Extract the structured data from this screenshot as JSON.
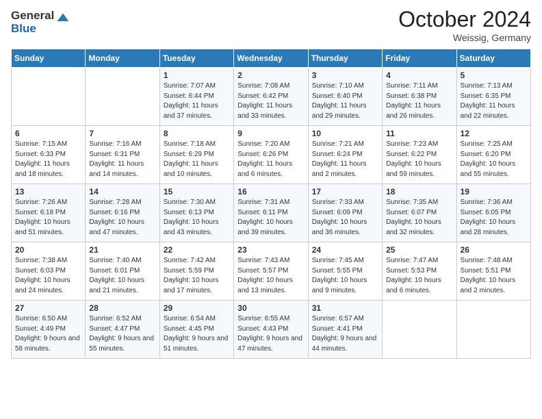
{
  "logo": {
    "general": "General",
    "blue": "Blue"
  },
  "header": {
    "month": "October 2024",
    "location": "Weissig, Germany"
  },
  "weekdays": [
    "Sunday",
    "Monday",
    "Tuesday",
    "Wednesday",
    "Thursday",
    "Friday",
    "Saturday"
  ],
  "weeks": [
    [
      {
        "day": "",
        "info": ""
      },
      {
        "day": "",
        "info": ""
      },
      {
        "day": "1",
        "info": "Sunrise: 7:07 AM\nSunset: 6:44 PM\nDaylight: 11 hours and 37 minutes."
      },
      {
        "day": "2",
        "info": "Sunrise: 7:08 AM\nSunset: 6:42 PM\nDaylight: 11 hours and 33 minutes."
      },
      {
        "day": "3",
        "info": "Sunrise: 7:10 AM\nSunset: 6:40 PM\nDaylight: 11 hours and 29 minutes."
      },
      {
        "day": "4",
        "info": "Sunrise: 7:11 AM\nSunset: 6:38 PM\nDaylight: 11 hours and 26 minutes."
      },
      {
        "day": "5",
        "info": "Sunrise: 7:13 AM\nSunset: 6:35 PM\nDaylight: 11 hours and 22 minutes."
      }
    ],
    [
      {
        "day": "6",
        "info": "Sunrise: 7:15 AM\nSunset: 6:33 PM\nDaylight: 11 hours and 18 minutes."
      },
      {
        "day": "7",
        "info": "Sunrise: 7:16 AM\nSunset: 6:31 PM\nDaylight: 11 hours and 14 minutes."
      },
      {
        "day": "8",
        "info": "Sunrise: 7:18 AM\nSunset: 6:29 PM\nDaylight: 11 hours and 10 minutes."
      },
      {
        "day": "9",
        "info": "Sunrise: 7:20 AM\nSunset: 6:26 PM\nDaylight: 11 hours and 6 minutes."
      },
      {
        "day": "10",
        "info": "Sunrise: 7:21 AM\nSunset: 6:24 PM\nDaylight: 11 hours and 2 minutes."
      },
      {
        "day": "11",
        "info": "Sunrise: 7:23 AM\nSunset: 6:22 PM\nDaylight: 10 hours and 59 minutes."
      },
      {
        "day": "12",
        "info": "Sunrise: 7:25 AM\nSunset: 6:20 PM\nDaylight: 10 hours and 55 minutes."
      }
    ],
    [
      {
        "day": "13",
        "info": "Sunrise: 7:26 AM\nSunset: 6:18 PM\nDaylight: 10 hours and 51 minutes."
      },
      {
        "day": "14",
        "info": "Sunrise: 7:28 AM\nSunset: 6:16 PM\nDaylight: 10 hours and 47 minutes."
      },
      {
        "day": "15",
        "info": "Sunrise: 7:30 AM\nSunset: 6:13 PM\nDaylight: 10 hours and 43 minutes."
      },
      {
        "day": "16",
        "info": "Sunrise: 7:31 AM\nSunset: 6:11 PM\nDaylight: 10 hours and 39 minutes."
      },
      {
        "day": "17",
        "info": "Sunrise: 7:33 AM\nSunset: 6:09 PM\nDaylight: 10 hours and 36 minutes."
      },
      {
        "day": "18",
        "info": "Sunrise: 7:35 AM\nSunset: 6:07 PM\nDaylight: 10 hours and 32 minutes."
      },
      {
        "day": "19",
        "info": "Sunrise: 7:36 AM\nSunset: 6:05 PM\nDaylight: 10 hours and 28 minutes."
      }
    ],
    [
      {
        "day": "20",
        "info": "Sunrise: 7:38 AM\nSunset: 6:03 PM\nDaylight: 10 hours and 24 minutes."
      },
      {
        "day": "21",
        "info": "Sunrise: 7:40 AM\nSunset: 6:01 PM\nDaylight: 10 hours and 21 minutes."
      },
      {
        "day": "22",
        "info": "Sunrise: 7:42 AM\nSunset: 5:59 PM\nDaylight: 10 hours and 17 minutes."
      },
      {
        "day": "23",
        "info": "Sunrise: 7:43 AM\nSunset: 5:57 PM\nDaylight: 10 hours and 13 minutes."
      },
      {
        "day": "24",
        "info": "Sunrise: 7:45 AM\nSunset: 5:55 PM\nDaylight: 10 hours and 9 minutes."
      },
      {
        "day": "25",
        "info": "Sunrise: 7:47 AM\nSunset: 5:53 PM\nDaylight: 10 hours and 6 minutes."
      },
      {
        "day": "26",
        "info": "Sunrise: 7:48 AM\nSunset: 5:51 PM\nDaylight: 10 hours and 2 minutes."
      }
    ],
    [
      {
        "day": "27",
        "info": "Sunrise: 6:50 AM\nSunset: 4:49 PM\nDaylight: 9 hours and 58 minutes."
      },
      {
        "day": "28",
        "info": "Sunrise: 6:52 AM\nSunset: 4:47 PM\nDaylight: 9 hours and 55 minutes."
      },
      {
        "day": "29",
        "info": "Sunrise: 6:54 AM\nSunset: 4:45 PM\nDaylight: 9 hours and 51 minutes."
      },
      {
        "day": "30",
        "info": "Sunrise: 6:55 AM\nSunset: 4:43 PM\nDaylight: 9 hours and 47 minutes."
      },
      {
        "day": "31",
        "info": "Sunrise: 6:57 AM\nSunset: 4:41 PM\nDaylight: 9 hours and 44 minutes."
      },
      {
        "day": "",
        "info": ""
      },
      {
        "day": "",
        "info": ""
      }
    ]
  ]
}
